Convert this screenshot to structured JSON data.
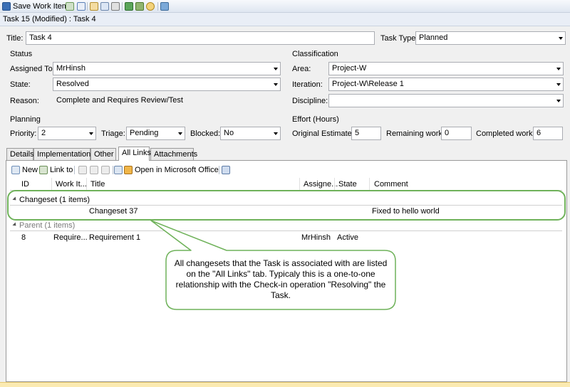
{
  "toolbar": {
    "save_label": "Save Work Item"
  },
  "window_title": "Task 15 (Modified) : Task 4",
  "form": {
    "title_label": "Title:",
    "title_value": "Task 4",
    "task_type_label": "Task Type:",
    "task_type_value": "Planned",
    "status_header": "Status",
    "assigned_to_label": "Assigned To:",
    "assigned_to_value": "MrHinsh",
    "state_label": "State:",
    "state_value": "Resolved",
    "reason_label": "Reason:",
    "reason_value": "Complete and Requires Review/Test",
    "classification_header": "Classification",
    "area_label": "Area:",
    "area_value": "Project-W",
    "iteration_label": "Iteration:",
    "iteration_value": "Project-W\\Release 1",
    "discipline_label": "Discipline:",
    "discipline_value": "",
    "planning_header": "Planning",
    "priority_label": "Priority:",
    "priority_value": "2",
    "triage_label": "Triage:",
    "triage_value": "Pending",
    "blocked_label": "Blocked:",
    "blocked_value": "No",
    "effort_header": "Effort (Hours)",
    "original_estimate_label": "Original Estimate:",
    "original_estimate_value": "5",
    "remaining_work_label": "Remaining work:",
    "remaining_work_value": "0",
    "completed_work_label": "Completed work:",
    "completed_work_value": "6"
  },
  "tabs": [
    {
      "label": "Details"
    },
    {
      "label": "Implementation"
    },
    {
      "label": "Other"
    },
    {
      "label": "All Links"
    },
    {
      "label": "Attachments"
    }
  ],
  "links_toolbar": {
    "new_label": "New",
    "link_to_label": "Link to",
    "open_office_label": "Open in Microsoft Office"
  },
  "grid": {
    "columns": [
      "ID",
      "Work It...",
      "Title",
      "Assigne...",
      "State",
      "Comment"
    ],
    "groups": [
      {
        "label": "Changeset (1 items)",
        "rows": [
          {
            "id": "",
            "work_item": "",
            "title": "Changeset 37",
            "assigned": "",
            "state": "",
            "comment": "Fixed to hello world"
          }
        ]
      },
      {
        "label": "Parent (1 items)",
        "rows": [
          {
            "id": "8",
            "work_item": "Require...",
            "title": "Requirement 1",
            "assigned": "MrHinsh",
            "state": "Active",
            "comment": ""
          }
        ]
      }
    ]
  },
  "callout": {
    "text": "All changesets that the Task is associated with are listed on the \"All Links\" tab. Typicaly this is a one-to-one relationship with the Check-in operation \"Resolving\" the Task.",
    "border_color": "#6fb25a"
  }
}
